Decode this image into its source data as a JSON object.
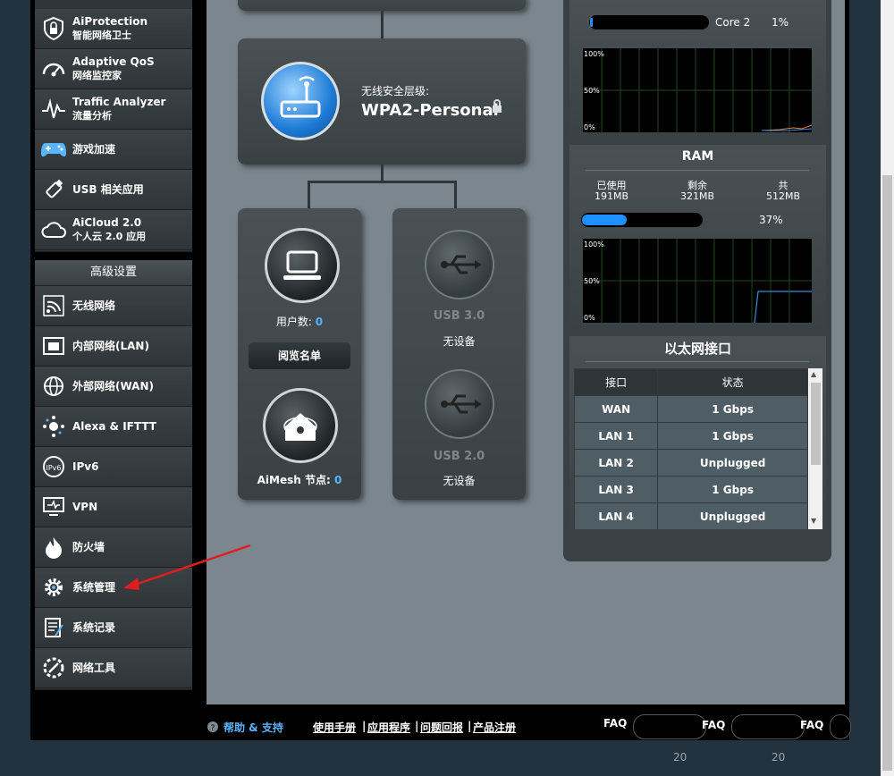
{
  "sidebar_general": [
    {
      "icon": "shield-icon",
      "label": "AiProtection",
      "sub": "智能网络卫士"
    },
    {
      "icon": "speedometer-icon",
      "label": "Adaptive QoS",
      "sub": "网络监控家"
    },
    {
      "icon": "pulse-icon",
      "label": "Traffic Analyzer",
      "sub": "流量分析"
    },
    {
      "icon": "gamepad-icon",
      "label": "游戏加速",
      "sub": ""
    },
    {
      "icon": "usb-icon",
      "label": "USB 相关应用",
      "sub": ""
    },
    {
      "icon": "cloud-icon",
      "label": "AiCloud 2.0",
      "sub": "个人云 2.0 应用"
    }
  ],
  "sidebar_advanced_title": "高级设置",
  "sidebar_advanced": [
    {
      "icon": "wifi-icon",
      "label": "无线网络"
    },
    {
      "icon": "lan-icon",
      "label": "内部网络(LAN)"
    },
    {
      "icon": "globe-icon",
      "label": "外部网络(WAN)"
    },
    {
      "icon": "alexa-icon",
      "label": "Alexa & IFTTT"
    },
    {
      "icon": "ipv6-icon",
      "label": "IPv6"
    },
    {
      "icon": "vpn-icon",
      "label": "VPN"
    },
    {
      "icon": "firewall-icon",
      "label": "防火墙"
    },
    {
      "icon": "gear-icon",
      "label": "系统管理"
    },
    {
      "icon": "log-icon",
      "label": "系统记录"
    },
    {
      "icon": "tools-icon",
      "label": "网络工具"
    }
  ],
  "router": {
    "security_label": "无线安全层级:",
    "security_value": "WPA2-Personal"
  },
  "clients": {
    "label": "用户数:",
    "count": "0",
    "button": "阅览名单"
  },
  "aimesh": {
    "label": "AiMesh 节点:",
    "count": "0"
  },
  "usb3": {
    "title": "USB 3.0",
    "status": "无设备"
  },
  "usb2": {
    "title": "USB 2.0",
    "status": "无设备"
  },
  "cpu": {
    "core_label": "Core 2",
    "core_value": "1%",
    "core_percent": 1,
    "axis": [
      "100%",
      "50%",
      "0%"
    ]
  },
  "ram": {
    "title": "RAM",
    "used_label": "已使用",
    "used": "191MB",
    "free_label": "剩余",
    "free": "321MB",
    "total_label": "共",
    "total": "512MB",
    "percent_text": "37%",
    "percent": 37,
    "axis": [
      "100%",
      "50%",
      "0%"
    ]
  },
  "ethernet": {
    "title": "以太网接口",
    "headers": [
      "接口",
      "状态"
    ],
    "rows": [
      [
        "WAN",
        "1 Gbps"
      ],
      [
        "LAN 1",
        "1 Gbps"
      ],
      [
        "LAN 2",
        "Unplugged"
      ],
      [
        "LAN 3",
        "1 Gbps"
      ],
      [
        "LAN 4",
        "Unplugged"
      ]
    ]
  },
  "footer": {
    "help": "帮助 & 支持",
    "links": [
      "使用手册",
      "应用程序",
      "问题回报",
      "产品注册"
    ],
    "faq": "FAQ",
    "year_text": "20",
    "colors": {
      "accent": "#5ab4ff",
      "bar": "#1e90ff"
    }
  }
}
